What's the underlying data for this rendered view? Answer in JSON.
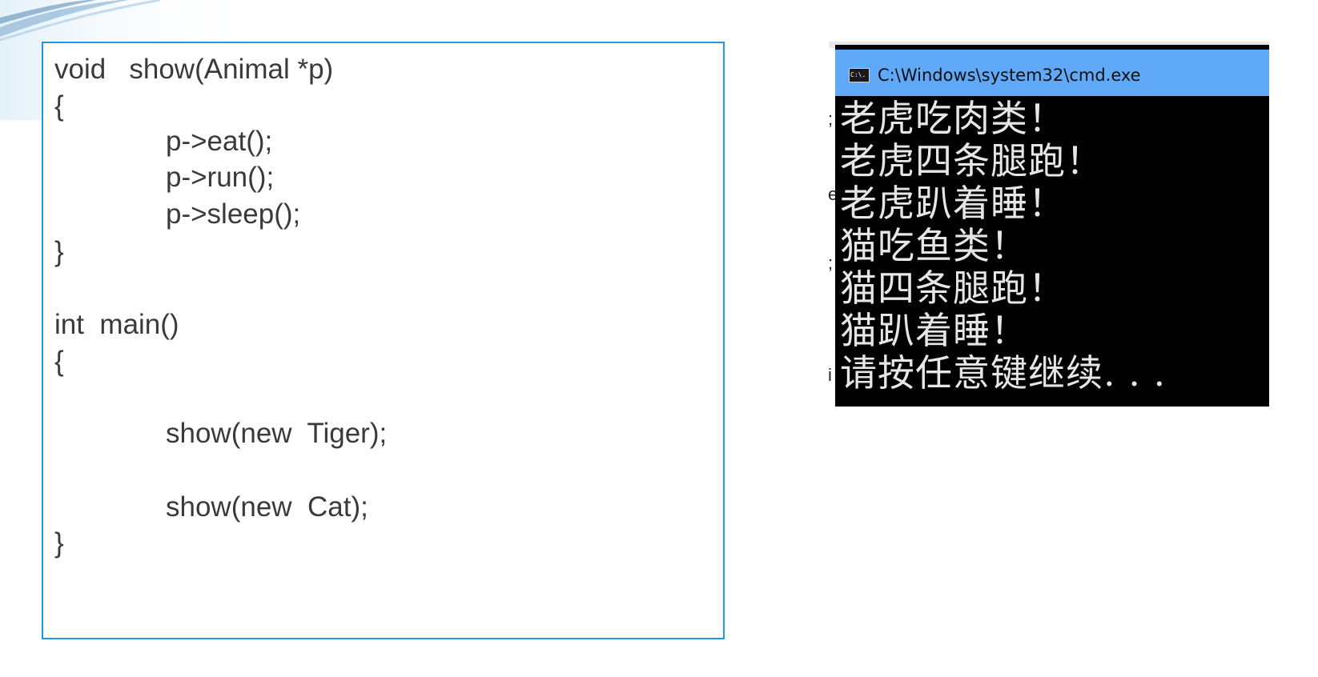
{
  "code": {
    "lines": [
      "void   show(Animal *p)",
      "{",
      "p->eat();",
      "p->run();",
      "p->sleep();",
      "}",
      "int  main()",
      "{",
      "show(new  Tiger);",
      "show(new  Cat);",
      "}"
    ]
  },
  "cmd": {
    "title": "C:\\Windows\\system32\\cmd.exe",
    "icon_label": "C:\\.",
    "icon": "cmd-icon",
    "titlebar_color": "#60a8f8",
    "output": [
      "老虎吃肉类！",
      "老虎四条腿跑！",
      "老虎趴着睡！",
      "猫吃鱼类！",
      "猫四条腿跑！",
      "猫趴着睡！",
      "请按任意键继续. . ."
    ]
  },
  "behind_window": {
    "fragments": [
      ";",
      "e",
      ";",
      "i"
    ]
  },
  "colors": {
    "code_border": "#1e9be0",
    "code_text": "#3a3a3a",
    "console_bg": "#000000",
    "console_text": "#e6e6e6"
  }
}
